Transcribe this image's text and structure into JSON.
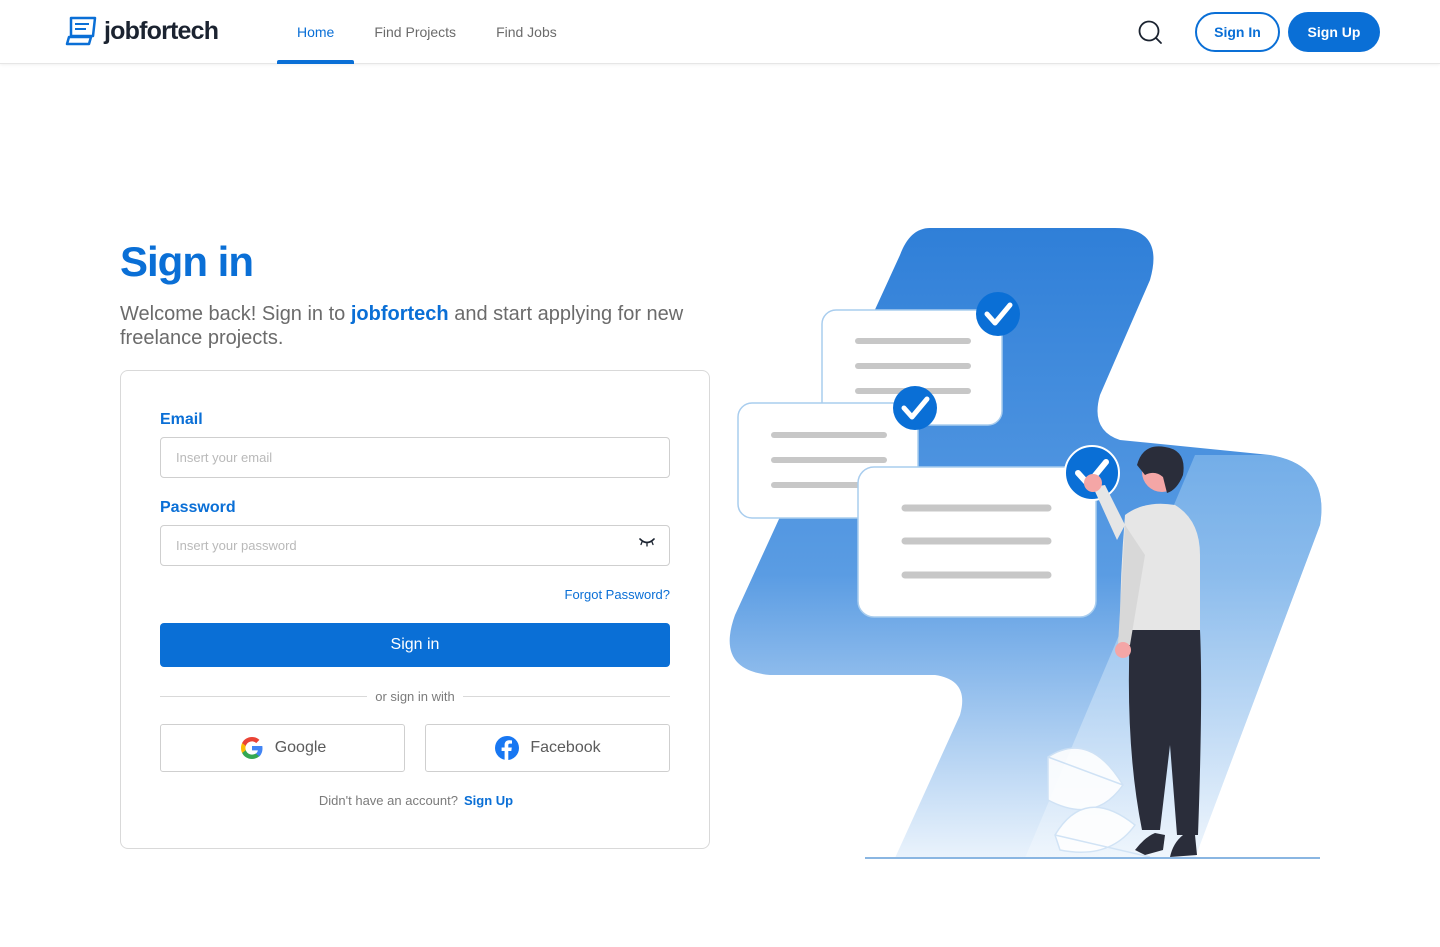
{
  "header": {
    "logo_text": "jobfortech",
    "nav": [
      "Home",
      "Find Projects",
      "Find Jobs"
    ],
    "active_nav": "Home",
    "sign_in_label": "Sign In",
    "sign_up_label": "Sign Up"
  },
  "main": {
    "title": "Sign in",
    "subtitle_before": "Welcome back! Sign in to ",
    "subtitle_brand": "jobfortech",
    "subtitle_after": " and start applying for new freelance projects."
  },
  "form": {
    "email_label": "Email",
    "email_placeholder": "Insert your email",
    "email_value": "",
    "password_label": "Password",
    "password_placeholder": "Insert your password",
    "password_value": "",
    "forgot_label": "Forgot Password?",
    "submit_label": "Sign in",
    "divider_text": "or sign in with",
    "google_label": "Google",
    "facebook_label": "Facebook",
    "no_account_text": "Didn't have an account?",
    "signup_link": "Sign Up"
  },
  "colors": {
    "primary": "#0a6fd6",
    "text_muted": "#6b6b6b"
  },
  "icons": {
    "search": "search-icon",
    "eye": "eye-closed-icon",
    "google": "google-icon",
    "facebook": "facebook-icon"
  }
}
